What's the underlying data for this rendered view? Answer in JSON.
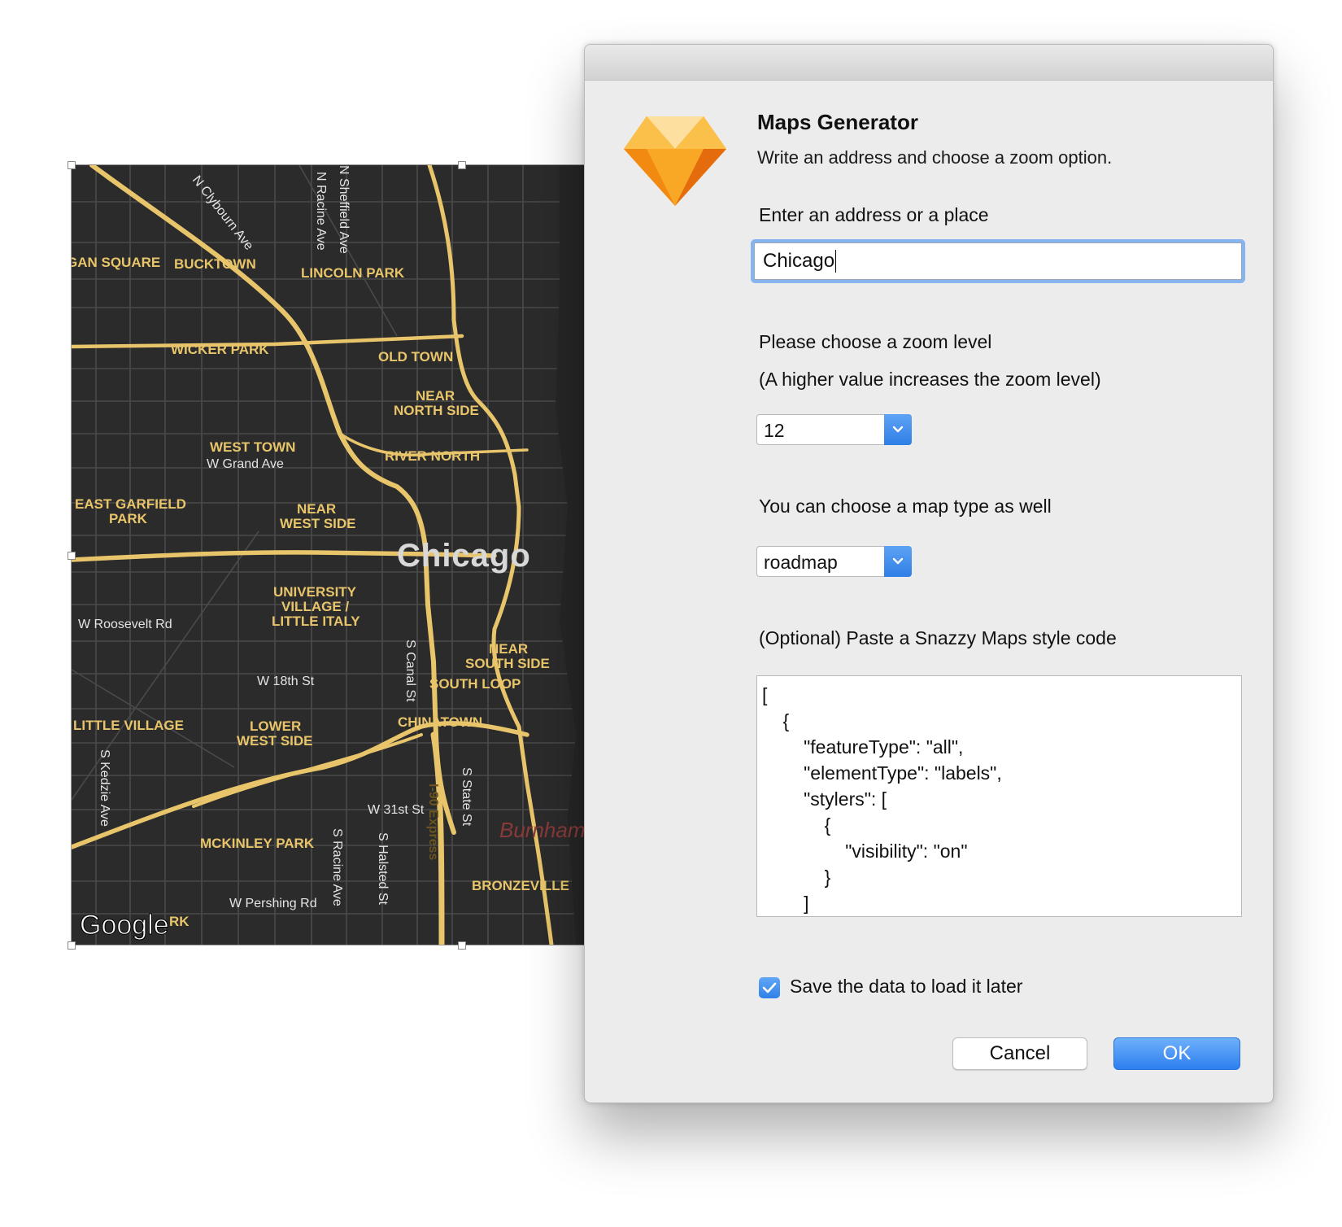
{
  "map": {
    "city_label": "Chicago",
    "logo": "Google",
    "neighborhoods": [
      "GAN SQUARE",
      "BUCKTOWN",
      "LINCOLN PARK",
      "WICKER PARK",
      "OLD TOWN",
      "NEAR",
      "NORTH SIDE",
      "WEST TOWN",
      "RIVER NORTH",
      "EAST GARFIELD",
      "PARK",
      "NEAR",
      "WEST SIDE",
      "UNIVERSITY",
      "VILLAGE /",
      "LITTLE ITALY",
      "NEAR",
      "SOUTH SIDE",
      "SOUTH LOOP",
      "LITTLE VILLAGE",
      "LOWER",
      "WEST SIDE",
      "CHINATOWN",
      "MCKINLEY PARK",
      "BRONZEVILLE",
      "RK"
    ],
    "streets": [
      "N Clybourn Ave",
      "N Racine Ave",
      "N Sheffield Ave",
      "W Grand Ave",
      "W Roosevelt Rd",
      "W 18th St",
      "S Canal St",
      "S Kedzie Ave",
      "W 31st St",
      "S State St",
      "S Racine Ave",
      "S Halsted St",
      "W Pershing Rd",
      "I-90 Express"
    ],
    "landmark": "Burnham"
  },
  "dialog": {
    "title": "Maps Generator",
    "subtitle": "Write an address and choose a zoom option.",
    "address_label": "Enter an address or a place",
    "address_value": "Chicago",
    "zoom_label": "Please choose a zoom level",
    "zoom_hint": "(A higher value increases the zoom level)",
    "zoom_value": "12",
    "maptype_label": "You can choose a map type as well",
    "maptype_value": "roadmap",
    "style_label": "(Optional) Paste a Snazzy Maps style code",
    "style_code": [
      "[",
      "    {",
      "        \"featureType\": \"all\",",
      "        \"elementType\": \"labels\",",
      "        \"stylers\": [",
      "            {",
      "                \"visibility\": \"on\"",
      "            }",
      "        ]"
    ],
    "save_label": "Save the data to load it later",
    "save_checked": true,
    "cancel_label": "Cancel",
    "ok_label": "OK"
  },
  "colors": {
    "map_bg": "#2b2b2b",
    "road": "#e8c56a",
    "accent": "#2f80e7"
  },
  "icons": {
    "app": "sketch-diamond-icon",
    "select_arrow": "chevron-down-icon",
    "checkbox": "checkmark-icon"
  }
}
